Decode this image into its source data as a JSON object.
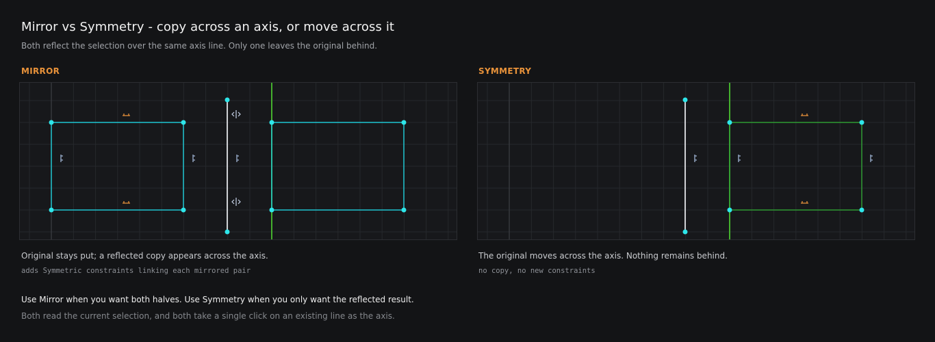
{
  "header": {
    "title": "Mirror vs Symmetry - copy across an axis, or move across it",
    "subtitle": "Both reflect the selection over the same axis line. Only one leaves the original behind."
  },
  "colors": {
    "accent": "#e8923a",
    "selection": "#1fc6d1",
    "point": "#2ee6ea",
    "axis": "#44b02e",
    "symmetry_shape": "#2f9a33",
    "line": "#d0d2d6"
  },
  "mirror": {
    "label": "MIRROR",
    "description": "Original stays put; a reflected copy appears across the axis.",
    "note": "adds Symmetric constraints linking each mirrored pair",
    "icons": [
      "horizontal-constraint-icon",
      "vertical-constraint-icon",
      "symmetric-constraint-icon"
    ]
  },
  "symmetry": {
    "label": "SYMMETRY",
    "description": "The original moves across the axis. Nothing remains behind.",
    "note": "no copy, no new constraints",
    "icons": [
      "horizontal-constraint-icon",
      "vertical-constraint-icon"
    ]
  },
  "footer": {
    "primary": "Use Mirror when you want both halves. Use Symmetry when you only want the reflected result.",
    "secondary": "Both read the current selection, and both take a single click on an existing line as the axis."
  }
}
